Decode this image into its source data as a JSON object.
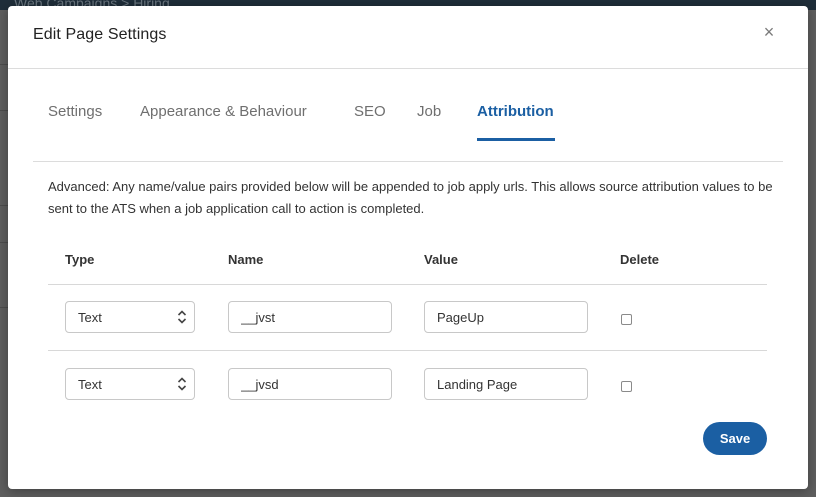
{
  "background": {
    "breadcrumb": "Web Campaigns  >  Hiring"
  },
  "modal": {
    "title": "Edit Page Settings",
    "close_glyph": "×"
  },
  "tabs": [
    {
      "label": "Settings",
      "active": false
    },
    {
      "label": "Appearance & Behaviour",
      "active": false
    },
    {
      "label": "SEO",
      "active": false
    },
    {
      "label": "Job",
      "active": false
    },
    {
      "label": "Attribution",
      "active": true
    }
  ],
  "description": "Advanced: Any name/value pairs provided below will be appended to job apply urls. This allows source attribution values to be sent to the ATS when a job application call to action is completed.",
  "table": {
    "headers": {
      "type": "Type",
      "name": "Name",
      "value": "Value",
      "delete": "Delete"
    },
    "rows": [
      {
        "type": "Text",
        "name": "__jvst",
        "value": "PageUp",
        "delete": false
      },
      {
        "type": "Text",
        "name": "__jvsd",
        "value": "Landing Page",
        "delete": false
      }
    ]
  },
  "save_label": "Save",
  "colors": {
    "accent": "#1b5fa3",
    "overlay": "#5b5b5b"
  },
  "icons": {
    "close": "close-icon",
    "select_chevrons": "chevron-up-down-icon"
  }
}
